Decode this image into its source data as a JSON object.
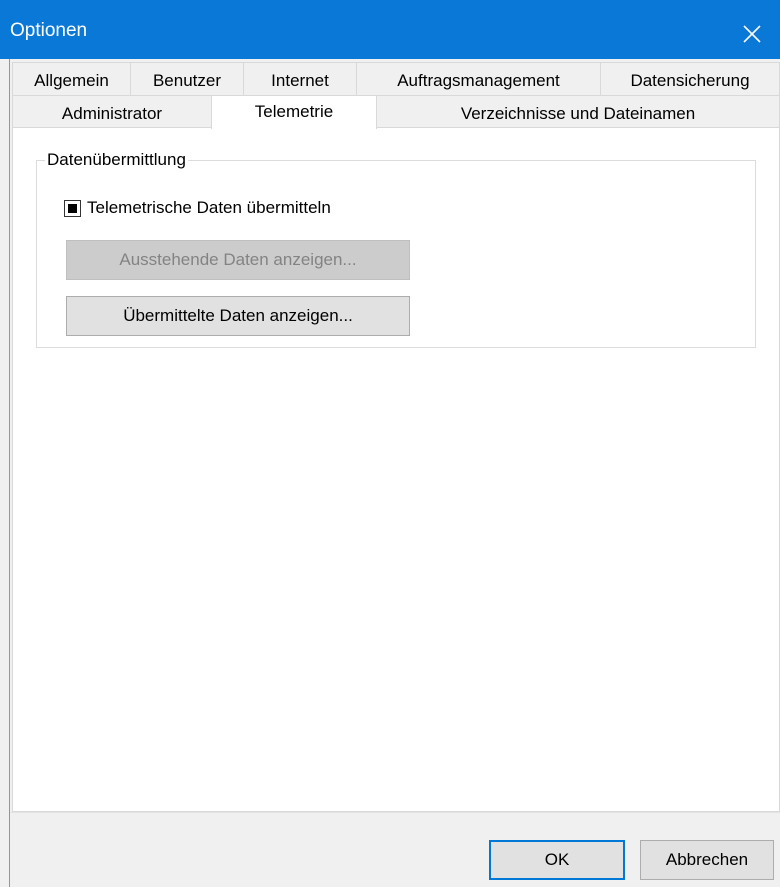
{
  "window": {
    "title": "Optionen"
  },
  "tabs": {
    "row1": [
      {
        "label": "Allgemein"
      },
      {
        "label": "Benutzer"
      },
      {
        "label": "Internet"
      },
      {
        "label": "Auftragsmanagement"
      },
      {
        "label": "Datensicherung"
      }
    ],
    "row2": [
      {
        "label": "Administrator"
      },
      {
        "label": "Telemetrie",
        "active": true
      },
      {
        "label": "Verzeichnisse und Dateinamen"
      }
    ]
  },
  "group": {
    "legend": "Datenübermittlung",
    "checkbox_label": "Telemetrische Daten übermitteln",
    "checkbox_state": "indeterminate",
    "pending_button": "Ausstehende Daten anzeigen...",
    "pending_button_enabled": false,
    "sent_button": "Übermittelte Daten anzeigen..."
  },
  "footer": {
    "ok_label": "OK",
    "cancel_label": "Abbrechen"
  },
  "colors": {
    "titlebar": "#0a78d7",
    "default_button_border": "#0078d7"
  },
  "icons": {
    "close": "close-icon"
  }
}
